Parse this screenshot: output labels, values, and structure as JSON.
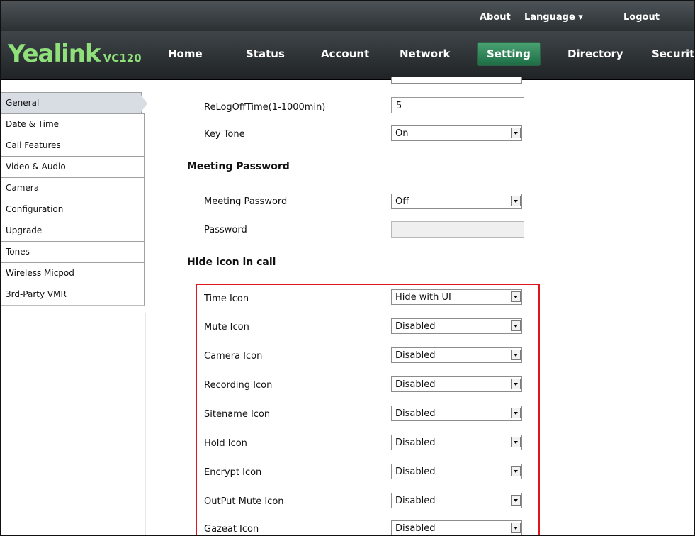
{
  "toplinks": {
    "about": "About",
    "language": "Language ▾",
    "logout": "Logout"
  },
  "brand": {
    "name": "Yealink",
    "model": "VC120"
  },
  "nav": {
    "home": "Home",
    "status": "Status",
    "account": "Account",
    "network": "Network",
    "setting": "Setting",
    "directory": "Directory",
    "security": "Security"
  },
  "sidebar": {
    "items": [
      {
        "label": "General"
      },
      {
        "label": "Date & Time"
      },
      {
        "label": "Call Features"
      },
      {
        "label": "Video & Audio"
      },
      {
        "label": "Camera"
      },
      {
        "label": "Configuration"
      },
      {
        "label": "Upgrade"
      },
      {
        "label": "Tones"
      },
      {
        "label": "Wireless Micpod"
      },
      {
        "label": "3rd-Party VMR"
      }
    ]
  },
  "form": {
    "relogoff": {
      "label": "ReLogOffTime(1-1000min)",
      "value": "5"
    },
    "keytone": {
      "label": "Key Tone",
      "value": "On"
    },
    "meeting_section": "Meeting Password",
    "meeting_password": {
      "label": "Meeting Password",
      "value": "Off"
    },
    "password": {
      "label": "Password",
      "value": ""
    },
    "hide_section": "Hide icon in call",
    "icons": [
      {
        "label": "Time Icon",
        "value": "Hide with UI"
      },
      {
        "label": "Mute Icon",
        "value": "Disabled"
      },
      {
        "label": "Camera Icon",
        "value": "Disabled"
      },
      {
        "label": "Recording Icon",
        "value": "Disabled"
      },
      {
        "label": "Sitename Icon",
        "value": "Disabled"
      },
      {
        "label": "Hold Icon",
        "value": "Disabled"
      },
      {
        "label": "Encrypt Icon",
        "value": "Disabled"
      },
      {
        "label": "OutPut Mute Icon",
        "value": "Disabled"
      },
      {
        "label": "Gazeat Icon",
        "value": "Disabled"
      }
    ]
  },
  "colors": {
    "brand_green": "#8fe07a",
    "active_tab": "#2f8a5b",
    "highlight": "#e0161b"
  }
}
